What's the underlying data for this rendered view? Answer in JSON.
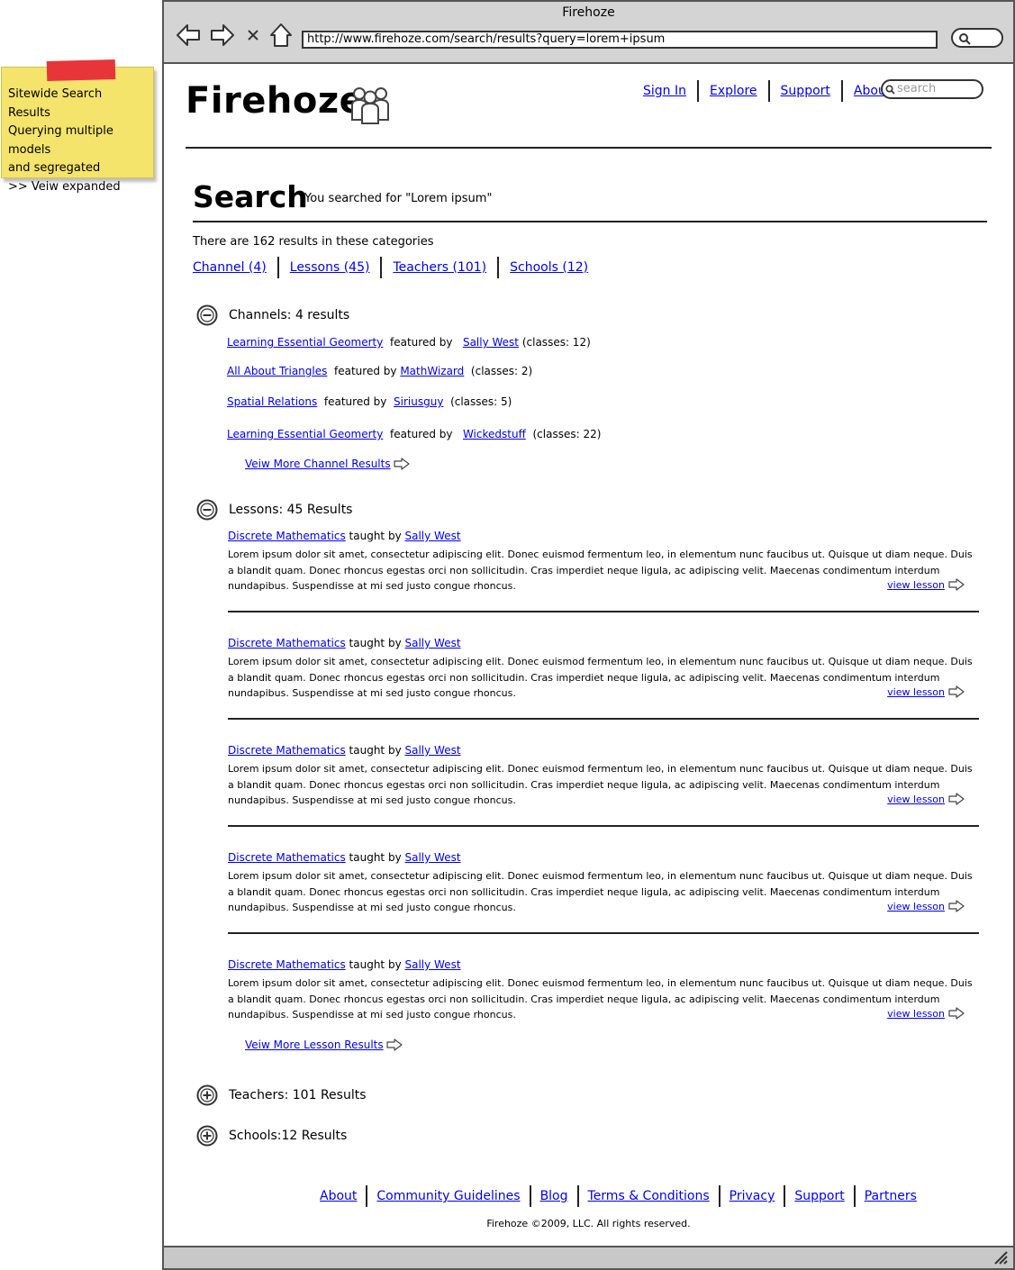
{
  "note": {
    "lines": [
      "Sitewide Search Results",
      "Querying multiple models",
      "and segregated",
      ">> Veiw expanded"
    ]
  },
  "browser": {
    "title": "Firehoze",
    "url": "http://www.firehoze.com/search/results?query=lorem+ipsum",
    "icons": [
      "back-arrow-icon",
      "forward-arrow-icon",
      "stop-x-icon",
      "home-icon",
      "search-icon"
    ]
  },
  "header": {
    "logo": "Firehoze",
    "logo_icon": "people-group-icon",
    "nav": [
      "Sign In",
      "Explore",
      "Support",
      "About"
    ],
    "search_placeholder": "search"
  },
  "search": {
    "title": "Search",
    "subtitle": "You searched for \"Lorem ipsum\"",
    "count_text": "There are 162 results in these categories",
    "categories": [
      "Channel (4)",
      "Lessons (45)",
      "Teachers (101)",
      "Schools (12)"
    ]
  },
  "channels": {
    "heading": "Channels: 4 results",
    "featured_by": "featured by",
    "items": [
      {
        "title": "Learning Essential Geomerty",
        "author": "Sally West",
        "classes": "(classes: 12)"
      },
      {
        "title": "All About Triangles",
        "author": "MathWizard",
        "classes": "(classes: 2)"
      },
      {
        "title": "Spatial Relations",
        "author": "Siriusguy",
        "classes": "(classes: 5)"
      },
      {
        "title": "Learning Essential Geomerty",
        "author": "Wickedstuff",
        "classes": "(classes: 22)"
      }
    ],
    "more": "Veiw More Channel Results"
  },
  "lessons": {
    "heading": "Lessons: 45 Results",
    "taught_by": "taught by",
    "view_label": "view lesson",
    "items": [
      {
        "title": "Discrete Mathematics",
        "author": "Sally West",
        "desc": "Lorem ipsum dolor sit amet, consectetur adipiscing elit. Donec euismod fermentum leo, in elementum nunc faucibus ut. Quisque ut diam neque. Duis a blandit quam. Donec rhoncus egestas orci non sollicitudin. Cras imperdiet neque ligula, ac adipiscing velit. Maecenas condimentum interdum nundapibus. Suspendisse at mi sed justo congue rhoncus."
      },
      {
        "title": "Discrete Mathematics",
        "author": "Sally West",
        "desc": "Lorem ipsum dolor sit amet, consectetur adipiscing elit. Donec euismod fermentum leo, in elementum nunc faucibus ut. Quisque ut diam neque. Duis a blandit quam. Donec rhoncus egestas orci non sollicitudin. Cras imperdiet neque ligula, ac adipiscing velit. Maecenas condimentum interdum nundapibus. Suspendisse at mi sed justo congue rhoncus."
      },
      {
        "title": "Discrete Mathematics",
        "author": "Sally West",
        "desc": "Lorem ipsum dolor sit amet, consectetur adipiscing elit. Donec euismod fermentum leo, in elementum nunc faucibus ut. Quisque ut diam neque. Duis a blandit quam. Donec rhoncus egestas orci non sollicitudin. Cras imperdiet neque ligula, ac adipiscing velit. Maecenas condimentum interdum nundapibus. Suspendisse at mi sed justo congue rhoncus."
      },
      {
        "title": "Discrete Mathematics",
        "author": "Sally West",
        "desc": "Lorem ipsum dolor sit amet, consectetur adipiscing elit. Donec euismod fermentum leo, in elementum nunc faucibus ut. Quisque ut diam neque. Duis a blandit quam. Donec rhoncus egestas orci non sollicitudin. Cras imperdiet neque ligula, ac adipiscing velit. Maecenas condimentum interdum nundapibus. Suspendisse at mi sed justo congue rhoncus."
      },
      {
        "title": "Discrete Mathematics",
        "author": "Sally West",
        "desc": "Lorem ipsum dolor sit amet, consectetur adipiscing elit. Donec euismod fermentum leo, in elementum nunc faucibus ut. Quisque ut diam neque. Duis a blandit quam. Donec rhoncus egestas orci non sollicitudin. Cras imperdiet neque ligula, ac adipiscing velit. Maecenas condimentum interdum nundapibus. Suspendisse at mi sed justo congue rhoncus."
      }
    ],
    "more": "Veiw More Lesson Results"
  },
  "teachers": {
    "heading": "Teachers: 101 Results"
  },
  "schools": {
    "heading": "Schools:12 Results"
  },
  "footer": {
    "links": [
      "About",
      "Community Guidelines",
      "Blog",
      "Terms & Conditions",
      "Privacy",
      "Support",
      "Partners"
    ],
    "copyright": "Firehoze ©2009, LLC. All rights reserved."
  },
  "colors": {
    "link": "#0000ee",
    "sticky": "#f4e46c",
    "tape": "#e8353a",
    "chrome": "#d4d4d4"
  }
}
